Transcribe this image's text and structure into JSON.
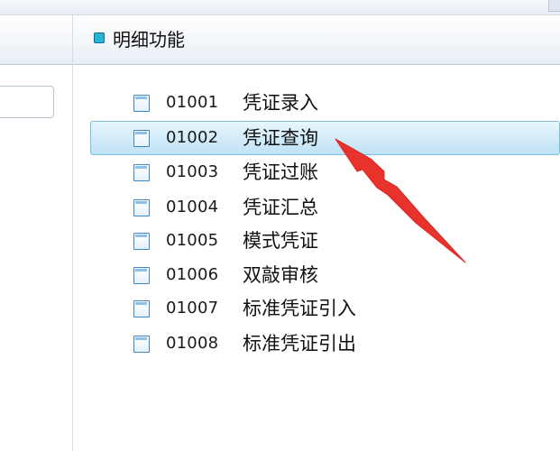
{
  "header": {
    "title": "明细功能"
  },
  "left_panel": {
    "input_value": ""
  },
  "menu": {
    "items": [
      {
        "code": "01001",
        "name": "凭证录入"
      },
      {
        "code": "01002",
        "name": "凭证查询"
      },
      {
        "code": "01003",
        "name": "凭证过账"
      },
      {
        "code": "01004",
        "name": "凭证汇总"
      },
      {
        "code": "01005",
        "name": "模式凭证"
      },
      {
        "code": "01006",
        "name": "双敲审核"
      },
      {
        "code": "01007",
        "name": "标准凭证引入"
      },
      {
        "code": "01008",
        "name": "标准凭证引出"
      }
    ]
  },
  "colors": {
    "accent": "#29b6d6",
    "selection": "#cde9fa",
    "annotation_arrow": "#e8322c"
  },
  "icons": {
    "header_marker": "square-bullet-icon",
    "item": "document-icon",
    "annotation": "red-arrow-icon"
  }
}
